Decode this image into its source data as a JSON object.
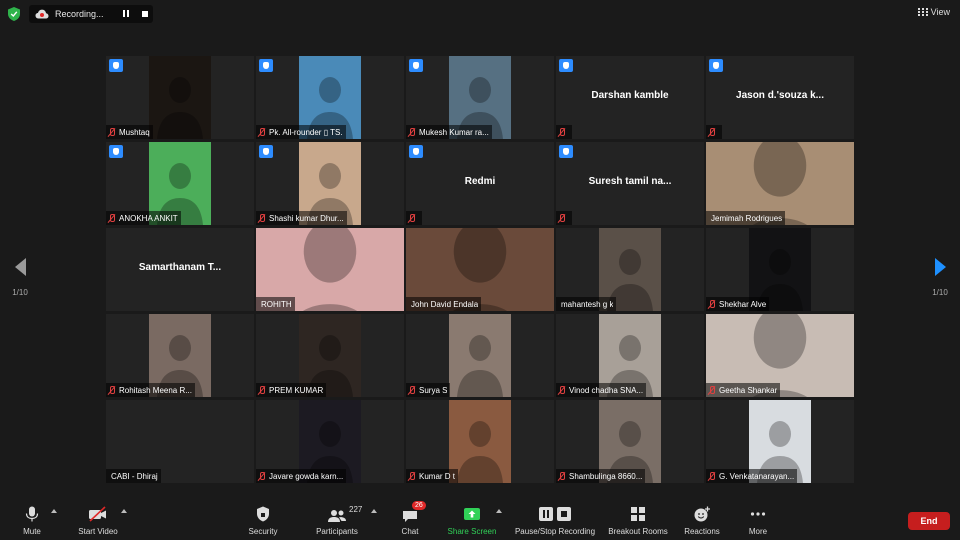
{
  "topbar": {
    "recording_label": "Recording...",
    "view_label": "View"
  },
  "pager": {
    "left_page": "1/10",
    "right_page": "1/10"
  },
  "tiles": [
    {
      "name": "Mushtaq",
      "video": true,
      "hand": true,
      "muted": true,
      "bg": "#1b1612"
    },
    {
      "name": "Pk. All-rounder ▯ TS.",
      "video": true,
      "hand": true,
      "muted": true,
      "bg": "#4a8ab8"
    },
    {
      "name": "Mukesh Kumar ra...",
      "video": true,
      "hand": true,
      "muted": true,
      "bg": "#567082"
    },
    {
      "name": "Darshan  kamble",
      "video": false,
      "hand": true,
      "muted": true
    },
    {
      "name": "Jason d.'souza k...",
      "video": false,
      "hand": true,
      "muted": true
    },
    {
      "name": "ANOKHA ANKIT",
      "video": true,
      "hand": true,
      "muted": true,
      "bg": "#4cae5a"
    },
    {
      "name": "Shashi kumar Dhur...",
      "video": true,
      "hand": true,
      "muted": true,
      "bg": "#c8a88c"
    },
    {
      "name": "Redmi",
      "video": false,
      "hand": true,
      "muted": true
    },
    {
      "name": "Suresh tamil na...",
      "video": false,
      "hand": true,
      "muted": true
    },
    {
      "name": "Jemimah Rodrigues",
      "video": true,
      "full": true,
      "hand": false,
      "muted": false,
      "bg": "#a88e74"
    },
    {
      "name": "Samarthanam  T...",
      "video": false,
      "hand": false,
      "muted": false,
      "no_plate": true
    },
    {
      "name": "ROHITH",
      "video": true,
      "full": true,
      "hand": false,
      "muted": false,
      "bg": "#d8a8a8"
    },
    {
      "name": "John David Endala",
      "video": true,
      "full": true,
      "hand": false,
      "muted": false,
      "active": true,
      "bg": "#6a4a3a"
    },
    {
      "name": "mahantesh g k",
      "video": true,
      "hand": false,
      "muted": false,
      "bg": "#5a5048"
    },
    {
      "name": "Shekhar Alve",
      "video": true,
      "hand": false,
      "muted": true,
      "bg": "#121214"
    },
    {
      "name": "Rohitash Meena R...",
      "video": true,
      "hand": false,
      "muted": true,
      "bg": "#7a6a62"
    },
    {
      "name": "PREM KUMAR",
      "video": true,
      "hand": false,
      "muted": true,
      "bg": "#2e2622"
    },
    {
      "name": "Surya S",
      "video": true,
      "hand": false,
      "muted": true,
      "bg": "#8a7a70"
    },
    {
      "name": "Vinod chadha SNA...",
      "video": true,
      "hand": false,
      "muted": true,
      "bg": "#a8a098"
    },
    {
      "name": "Geetha Shankar",
      "video": true,
      "full": true,
      "hand": false,
      "muted": true,
      "bg": "#c8bcb4"
    },
    {
      "name": "CABI - Dhiraj",
      "video": false,
      "hand": false,
      "muted": false,
      "plate_only": true
    },
    {
      "name": "Javare gowda karn...",
      "video": true,
      "hand": false,
      "muted": true,
      "bg": "#1c1a22"
    },
    {
      "name": "Kumar D t",
      "video": true,
      "hand": false,
      "muted": true,
      "bg": "#8a5a40"
    },
    {
      "name": "Shambulinga 8660...",
      "video": true,
      "hand": false,
      "muted": true,
      "bg": "#7a6e66"
    },
    {
      "name": "G. Venkatanarayan...",
      "video": true,
      "hand": false,
      "muted": true,
      "bg": "#d8dce0"
    }
  ],
  "toolbar": {
    "mute_label": "Mute",
    "start_video_label": "Start Video",
    "security_label": "Security",
    "participants_label": "Participants",
    "participants_count": "227",
    "chat_label": "Chat",
    "chat_badge": "26",
    "share_screen_label": "Share Screen",
    "recording_label": "Pause/Stop Recording",
    "breakout_label": "Breakout Rooms",
    "reactions_label": "Reactions",
    "more_label": "More",
    "end_label": "End"
  },
  "colors": {
    "background": "#1a1a1a",
    "tile": "#232323",
    "accent_blue": "#2d8cff",
    "share_green": "#31d158",
    "end_red": "#c61e1e",
    "active_speaker": "#e1e17a"
  }
}
